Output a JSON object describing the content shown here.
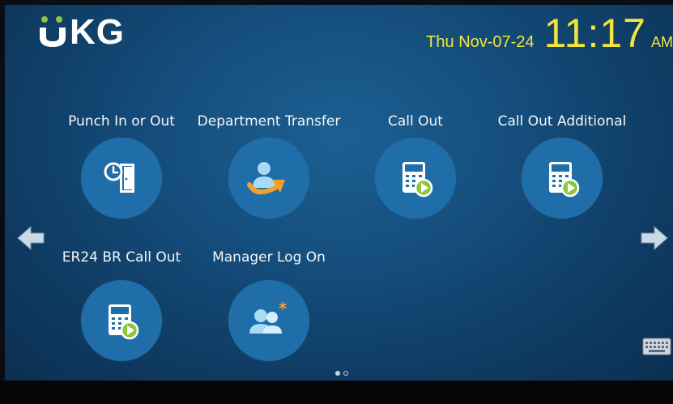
{
  "header": {
    "logo_text": "KG",
    "date": "Thu Nov-07-24",
    "time": "11:17",
    "ampm": "AM"
  },
  "tiles": [
    {
      "label": "Punch In or Out",
      "icon": "punch-clock-door-icon"
    },
    {
      "label": "Department Transfer",
      "icon": "department-transfer-icon"
    },
    {
      "label": "Call Out",
      "icon": "call-out-keypad-icon"
    },
    {
      "label": "Call Out Additional",
      "icon": "call-out-keypad-icon"
    },
    {
      "label": "ER24 BR Call Out",
      "icon": "call-out-keypad-icon"
    },
    {
      "label": "Manager Log On",
      "icon": "manager-logon-icon"
    }
  ],
  "pagination": {
    "pages": 2,
    "current": 1
  },
  "colors": {
    "accent_yellow": "#f2e63c",
    "logo_green": "#8cc63f",
    "tile_circle": "#1f6ea9",
    "background": "#154f7e"
  }
}
